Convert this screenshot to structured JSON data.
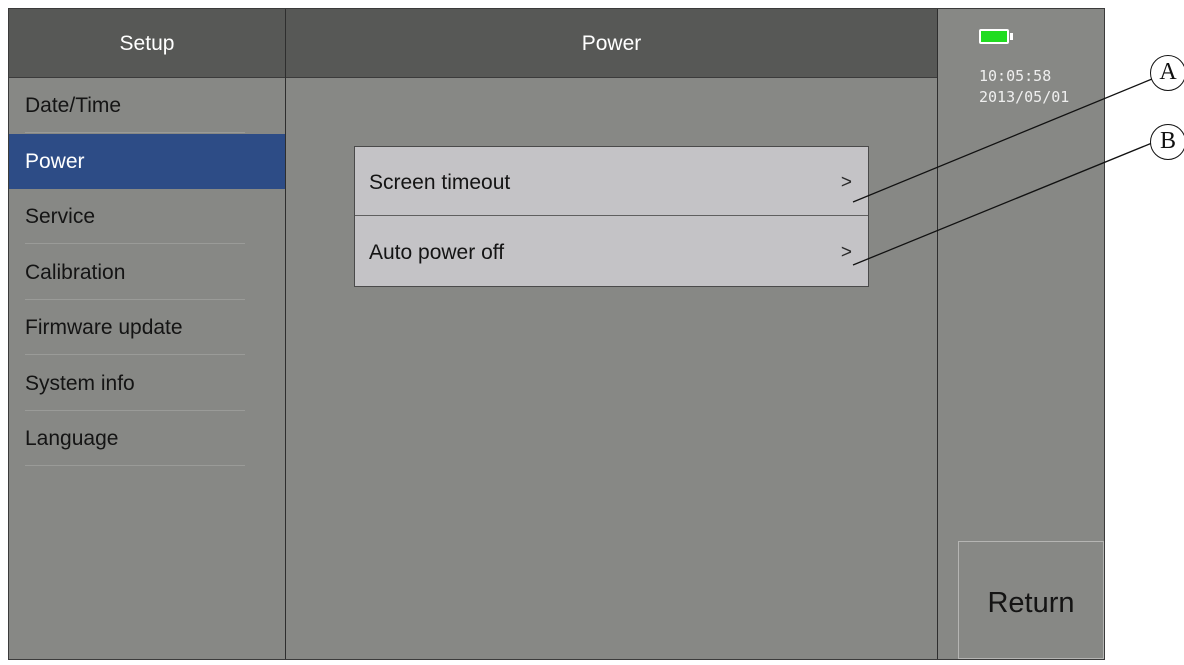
{
  "sidebar": {
    "title": "Setup",
    "items": [
      {
        "label": "Date/Time"
      },
      {
        "label": "Power"
      },
      {
        "label": "Service"
      },
      {
        "label": "Calibration"
      },
      {
        "label": "Firmware update"
      },
      {
        "label": "System info"
      },
      {
        "label": "Language"
      }
    ],
    "active_item": "Power"
  },
  "main": {
    "title": "Power",
    "menu": [
      {
        "label": "Screen timeout",
        "chevron": ">"
      },
      {
        "label": "Auto power off",
        "chevron": ">"
      }
    ]
  },
  "status": {
    "battery_icon": "battery-full-icon",
    "battery_color": "#20dc20",
    "time": "10:05:58",
    "date": "2013/05/01"
  },
  "buttons": {
    "return_label": "Return"
  },
  "callouts": {
    "a": "A",
    "b": "B"
  },
  "colors": {
    "screen_bg": "#878885",
    "header_bg": "#575856",
    "active_item_bg": "#2d4c86",
    "menu_box_bg": "#c4c3c6"
  }
}
